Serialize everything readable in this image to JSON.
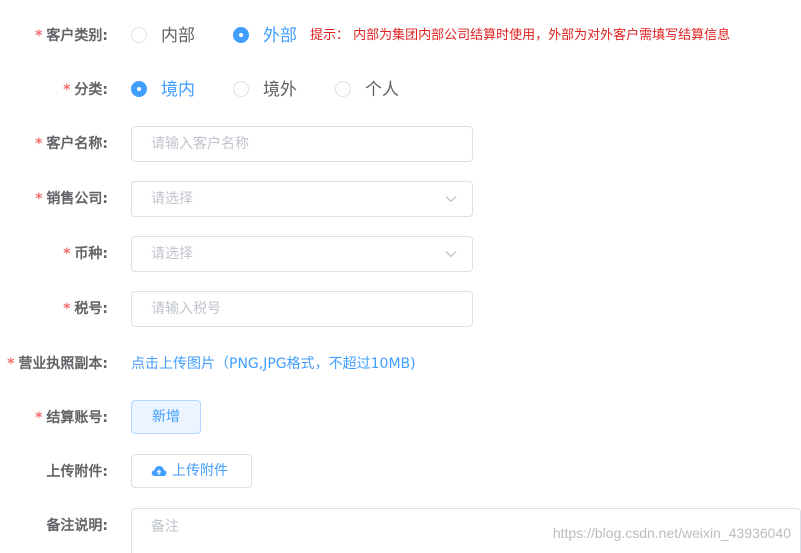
{
  "form": {
    "customer_type": {
      "label": "客户类别:",
      "options": [
        "内部",
        "外部"
      ],
      "selected": "外部",
      "hint": "提示： 内部为集团内部公司结算时使用，外部为对外客户需填写结算信息"
    },
    "category": {
      "label": "分类:",
      "options": [
        "境内",
        "境外",
        "个人"
      ],
      "selected": "境内"
    },
    "customer_name": {
      "label": "客户名称:",
      "placeholder": "请输入客户名称",
      "value": ""
    },
    "sales_company": {
      "label": "销售公司:",
      "placeholder": "请选择"
    },
    "currency": {
      "label": "币种:",
      "placeholder": "请选择"
    },
    "tax_number": {
      "label": "税号:",
      "placeholder": "请输入税号",
      "value": ""
    },
    "business_license": {
      "label": "营业执照副本:",
      "upload_text": "点击上传图片（PNG,JPG格式，不超过10MB)"
    },
    "settlement_account": {
      "label": "结算账号:",
      "add_label": "新增"
    },
    "attachment": {
      "label": "上传附件:",
      "upload_label": "上传附件"
    },
    "remark": {
      "label": "备注说明:",
      "placeholder": "备注"
    },
    "required_mark": "*"
  },
  "watermark": "https://blog.csdn.net/weixin_43936040",
  "colors": {
    "primary": "#409eff",
    "required": "#f56c6c",
    "hint": "#e02020",
    "border": "#dcdfe6",
    "placeholder": "#c0c4cc"
  },
  "icons": {
    "select_arrow": "chevron-down-icon",
    "upload": "cloud-upload-icon"
  }
}
